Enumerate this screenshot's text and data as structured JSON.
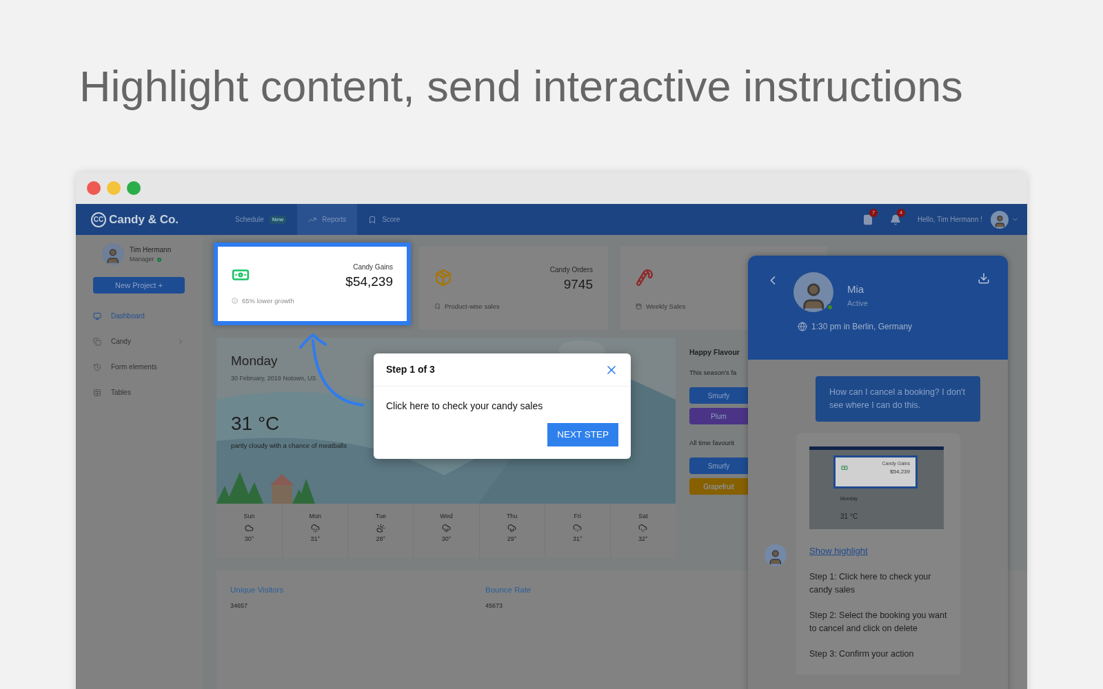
{
  "heading": "Highlight content, send interactive instructions",
  "window_controls": [
    {
      "color": "#ee5a52"
    },
    {
      "color": "#f5c33b"
    },
    {
      "color": "#2aae4a"
    }
  ],
  "navbar": {
    "logo_text": "CC",
    "brand": "Candy & Co.",
    "tabs": [
      {
        "label": "Schedule",
        "badge": "New",
        "selected": false
      },
      {
        "label": "Reports",
        "selected": true
      },
      {
        "label": "Score",
        "selected": false
      }
    ],
    "notifications": [
      {
        "kind": "document",
        "count": "7"
      },
      {
        "kind": "bell",
        "count": "4"
      }
    ],
    "greeting": "Hello, Tim Hermann !"
  },
  "sidebar": {
    "user": {
      "name": "Tim Hermann",
      "role": "Manager",
      "online": true
    },
    "new_project_button": "New Project +",
    "items": [
      {
        "label": "Dashboard",
        "selected": true,
        "expandable": false
      },
      {
        "label": "Candy",
        "selected": false,
        "expandable": true
      },
      {
        "label": "Form elements",
        "selected": false,
        "expandable": false
      },
      {
        "label": "Tables",
        "selected": false,
        "expandable": false
      }
    ]
  },
  "cards": [
    {
      "kind": "money",
      "label": "Candy Gains",
      "value": "$54,239",
      "note": "65% lower growth",
      "highlighted": true
    },
    {
      "kind": "box",
      "label": "Candy Orders",
      "value": "9745",
      "note": "Product-wise sales",
      "highlighted": false
    },
    {
      "kind": "candy",
      "note": "Weekly Sales",
      "highlighted": false
    }
  ],
  "weather": {
    "day": "Monday",
    "date_location": "30 February, 2019 Notown, US",
    "temperature": "31 °C",
    "description": "partly cloudy with a chance of meatballs",
    "forecast": [
      {
        "day": "Sun",
        "kind": "cloudy",
        "temp": "30°"
      },
      {
        "day": "Mon",
        "kind": "drizzle",
        "temp": "31°"
      },
      {
        "day": "Tue",
        "kind": "partly_sunny",
        "temp": "28°"
      },
      {
        "day": "Wed",
        "kind": "rain",
        "temp": "30°"
      },
      {
        "day": "Thu",
        "kind": "rain",
        "temp": "29°"
      },
      {
        "day": "Fri",
        "kind": "snow",
        "temp": "31°"
      },
      {
        "day": "Sat",
        "kind": "snow",
        "temp": "32°"
      }
    ]
  },
  "flavours": {
    "title": "Happy Flavour",
    "sections": [
      {
        "subtitle": "This season's fa",
        "items": [
          {
            "label": "Smurfy",
            "color": "#1e4c92"
          },
          {
            "label": "Plum",
            "color": "#4b3486"
          }
        ]
      },
      {
        "subtitle": "All time favourit",
        "items": [
          {
            "label": "Smurfy",
            "color": "#1e4c92"
          },
          {
            "label": "Grapefruit",
            "color": "#876000"
          }
        ]
      }
    ]
  },
  "visitor_stats": [
    {
      "label": "Unique Visitors",
      "value": "34657"
    },
    {
      "label": "Bounce Rate",
      "value": "45673"
    }
  ],
  "tour_dialog": {
    "title": "Step 1 of 3",
    "body": "Click here to check your candy sales",
    "button": "NEXT STEP"
  },
  "chat": {
    "agent": {
      "name": "Mia",
      "status": "Active",
      "online": true,
      "local_time": "1:30 pm in Berlin, Germany"
    },
    "messages": [
      {
        "kind": "user",
        "text": "How can I cancel a booking? I don't see where I can do this."
      },
      {
        "kind": "agent",
        "thumbnail": {
          "label": "Candy Gains",
          "value": "$54,239",
          "day": "Monday",
          "temperature": "31 °C"
        },
        "link": "Show highlight",
        "steps": [
          "Step 1: Click here to check your candy sales",
          "Step 2: Select the booking you want to cancel and click on delete",
          "Step 3: Confirm your action"
        ]
      }
    ]
  }
}
